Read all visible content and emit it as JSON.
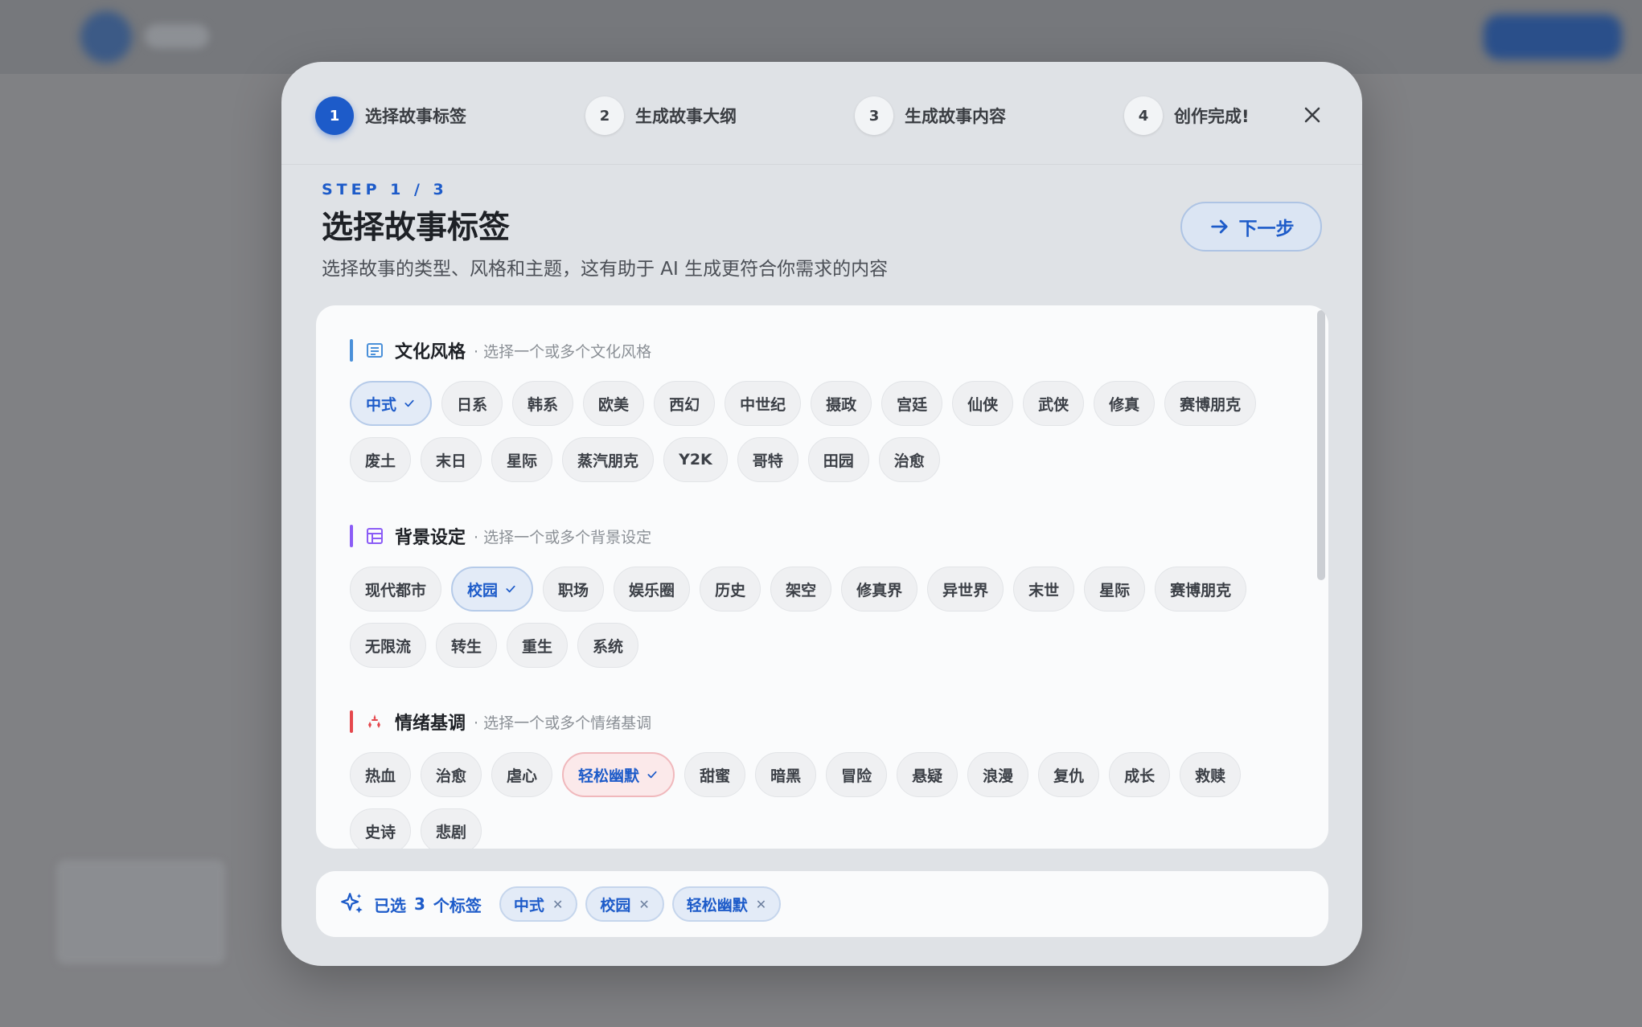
{
  "stepper": {
    "steps": [
      {
        "num": "1",
        "label": "选择故事标签"
      },
      {
        "num": "2",
        "label": "生成故事大纲"
      },
      {
        "num": "3",
        "label": "生成故事内容"
      },
      {
        "num": "4",
        "label": "创作完成!"
      }
    ],
    "active": 1
  },
  "header": {
    "kicker": "STEP 1 / 3",
    "title": "选择故事标签",
    "description": "选择故事的类型、风格和主题，这有助于 AI 生成更符合你需求的内容",
    "next_label": "下一步"
  },
  "sections": {
    "culture": {
      "title": "文化风格",
      "hint": "· 选择一个或多个文化风格",
      "color": "#4a90d9",
      "tags": [
        "中式",
        "日系",
        "韩系",
        "欧美",
        "西幻",
        "中世纪",
        "摄政",
        "宫廷",
        "仙侠",
        "武侠",
        "修真",
        "赛博朋克",
        "废土",
        "末日",
        "星际",
        "蒸汽朋克",
        "Y2K",
        "哥特",
        "田园",
        "治愈"
      ],
      "selected": [
        "中式"
      ]
    },
    "background": {
      "title": "背景设定",
      "hint": "· 选择一个或多个背景设定",
      "color": "#8b5cf6",
      "tags": [
        "现代都市",
        "校园",
        "职场",
        "娱乐圈",
        "历史",
        "架空",
        "修真界",
        "异世界",
        "末世",
        "星际",
        "赛博朋克",
        "无限流",
        "转生",
        "重生",
        "系统"
      ],
      "selected": [
        "校园"
      ]
    },
    "mood": {
      "title": "情绪基调",
      "hint": "· 选择一个或多个情绪基调",
      "color": "#e5484d",
      "tags": [
        "热血",
        "治愈",
        "虐心",
        "轻松幽默",
        "甜蜜",
        "暗黑",
        "冒险",
        "悬疑",
        "浪漫",
        "复仇",
        "成长",
        "救赎",
        "史诗",
        "悲剧"
      ],
      "selected": [
        "轻松幽默"
      ]
    }
  },
  "summary": {
    "prefix": "已选",
    "count": "3",
    "suffix": "个标签",
    "chips": [
      "中式",
      "校园",
      "轻松幽默"
    ]
  }
}
